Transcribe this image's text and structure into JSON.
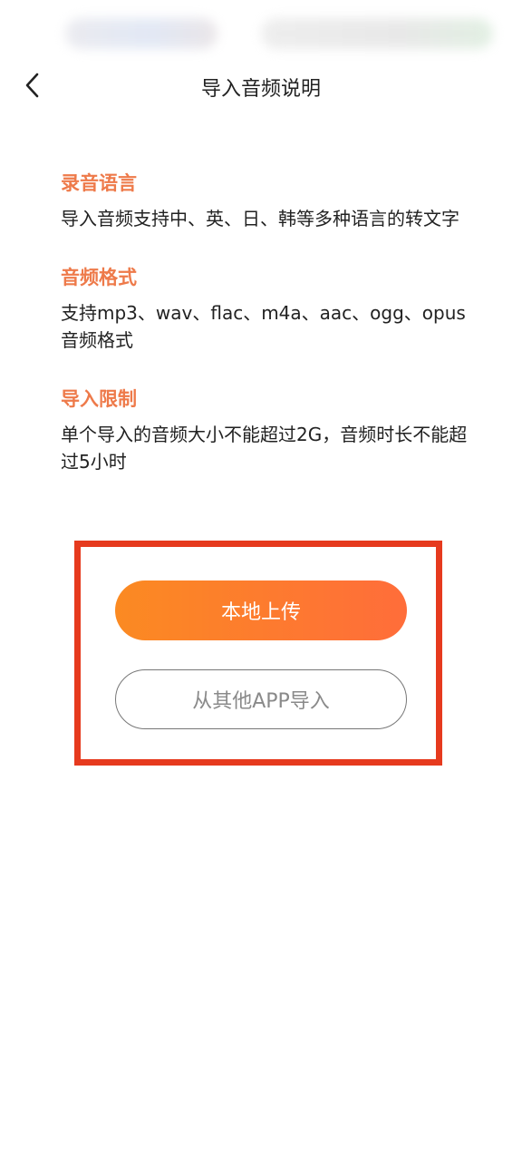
{
  "header": {
    "title": "导入音频说明",
    "back_icon": "chevron-left-icon"
  },
  "sections": [
    {
      "title": "录音语言",
      "text": "导入音频支持中、英、日、韩等多种语言的转文字"
    },
    {
      "title": "音频格式",
      "text": "支持mp3、wav、flac、m4a、aac、ogg、opus音频格式"
    },
    {
      "title": "导入限制",
      "text": "单个导入的音频大小不能超过2G，音频时长不能超过5小时"
    }
  ],
  "actions": {
    "local_upload_label": "本地上传",
    "import_from_app_label": "从其他APP导入"
  },
  "colors": {
    "accent": "#ee7a4a",
    "button_gradient_start": "#fb8a22",
    "button_gradient_end": "#ff6d3a",
    "highlight_border": "#e63a1e"
  }
}
